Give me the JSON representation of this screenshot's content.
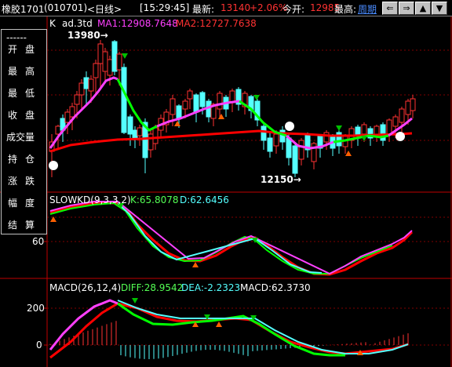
{
  "header": {
    "name": "橡胶1701",
    "code": "(010701)",
    "period": "<日线>",
    "time": "[15:29:45]",
    "latest_label": "最新:",
    "latest_value": "13140",
    "change_pct": "+2.06%",
    "open_label": "今开:",
    "open_value": "12985",
    "high_label": "最高:",
    "period_link": "周期",
    "buttons": [
      "⇐",
      "⇒",
      "▲",
      "▼"
    ]
  },
  "sidepanel": {
    "dashes": "------",
    "items": [
      "开盘",
      "最高",
      "最低",
      "收盘",
      "成交量",
      "持仓",
      "涨跌",
      "幅度",
      "结算"
    ]
  },
  "main_chart": {
    "indicator_k": "K",
    "indicator_name": "ad.3td",
    "ma1": "MA1:12908.7648",
    "ma2": "MA2:12727.7638",
    "peak_label": "13980→",
    "trough_label": "12150→"
  },
  "kd_chart": {
    "title": "SLOWKD(9,3,3,2)",
    "k": "K:65.8078",
    "d": "D:62.6456",
    "axis_label": "60"
  },
  "macd_chart": {
    "title": "MACD(26,12,4)",
    "diff": "DIFF:28.9542",
    "dea": "DEA:-2.2323",
    "macd": "MACD:62.3730",
    "axis_200": "200",
    "axis_0": "0"
  },
  "colors": {
    "up": "#ff3232",
    "down": "#54ffff",
    "ma1": "#ff40ff",
    "ma2": "#ff0000",
    "green_seg": "#00ff00",
    "grid": "#800000",
    "yellow": "#ffff00"
  }
}
